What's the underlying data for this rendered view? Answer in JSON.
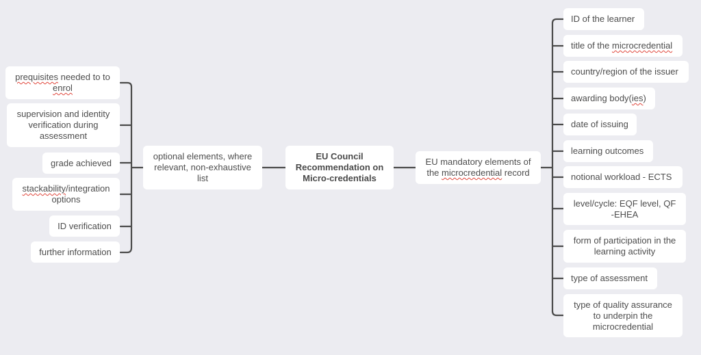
{
  "diagram": {
    "type": "mind-map",
    "central_node": "EU Council Recommendation on Micro-credentials",
    "central_node_lines": [
      "EU Council",
      "Recommendation on",
      "Micro-credentials"
    ],
    "left_branch": {
      "label": "optional elements, where relevant, non-exhaustive list",
      "children": [
        {
          "text_pre": "",
          "text_flag": "prequisites",
          "text_post": " needed to to ",
          "text_flag2": "enrol"
        },
        {
          "text": "supervision and identity verification during assessment"
        },
        {
          "text": "grade achieved"
        },
        {
          "text_pre": "",
          "text_flag": "stackability",
          "text_post": "/integration options"
        },
        {
          "text": "ID verification"
        },
        {
          "text": "further information"
        }
      ]
    },
    "right_branch": {
      "label_pre": "EU mandatory elements of the ",
      "label_flag": "microcredential",
      "label_post": " record",
      "children": [
        {
          "text": "ID of the learner"
        },
        {
          "text_pre": "title of the ",
          "text_flag": "microcredential",
          "text_post": ""
        },
        {
          "text": "country/region of the issuer"
        },
        {
          "text_pre": "awarding body(",
          "text_flag": "ies",
          "text_post": ")"
        },
        {
          "text": "date of issuing"
        },
        {
          "text": "learning outcomes"
        },
        {
          "text": "notional workload - ECTS"
        },
        {
          "text": "level/cycle: EQF level, QF -EHEA"
        },
        {
          "text": "form of participation in the learning activity"
        },
        {
          "text": "type of assessment"
        },
        {
          "text": "type of quality assurance to underpin the microcredential"
        }
      ]
    },
    "colors": {
      "background": "#ececf1",
      "node_fill": "#ffffff",
      "connector": "#4a4a4a",
      "text": "#4d4d4d",
      "spellcheck_underline": "#e0453a"
    }
  }
}
